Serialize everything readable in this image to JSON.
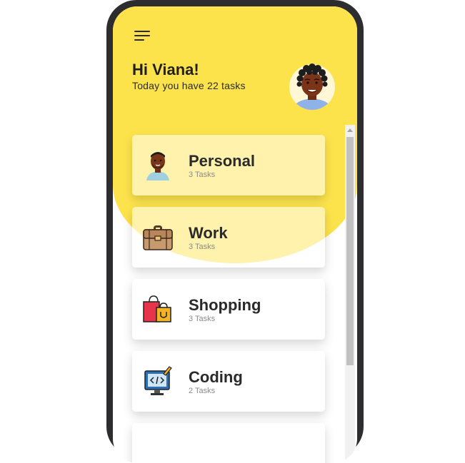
{
  "header": {
    "greeting": "Hi Viana!",
    "subtitle": "Today you have 22 tasks"
  },
  "categories": [
    {
      "title": "Personal",
      "count": "3 Tasks",
      "icon": "person-icon"
    },
    {
      "title": "Work",
      "count": "3 Tasks",
      "icon": "briefcase-icon"
    },
    {
      "title": "Shopping",
      "count": "3 Tasks",
      "icon": "shopping-bags-icon"
    },
    {
      "title": "Coding",
      "count": "2 Tasks",
      "icon": "computer-code-icon"
    }
  ],
  "colors": {
    "accent": "#fde34b",
    "frame": "#2d2d2f",
    "text": "#2a2a2a",
    "muted": "#8a8a8a"
  }
}
